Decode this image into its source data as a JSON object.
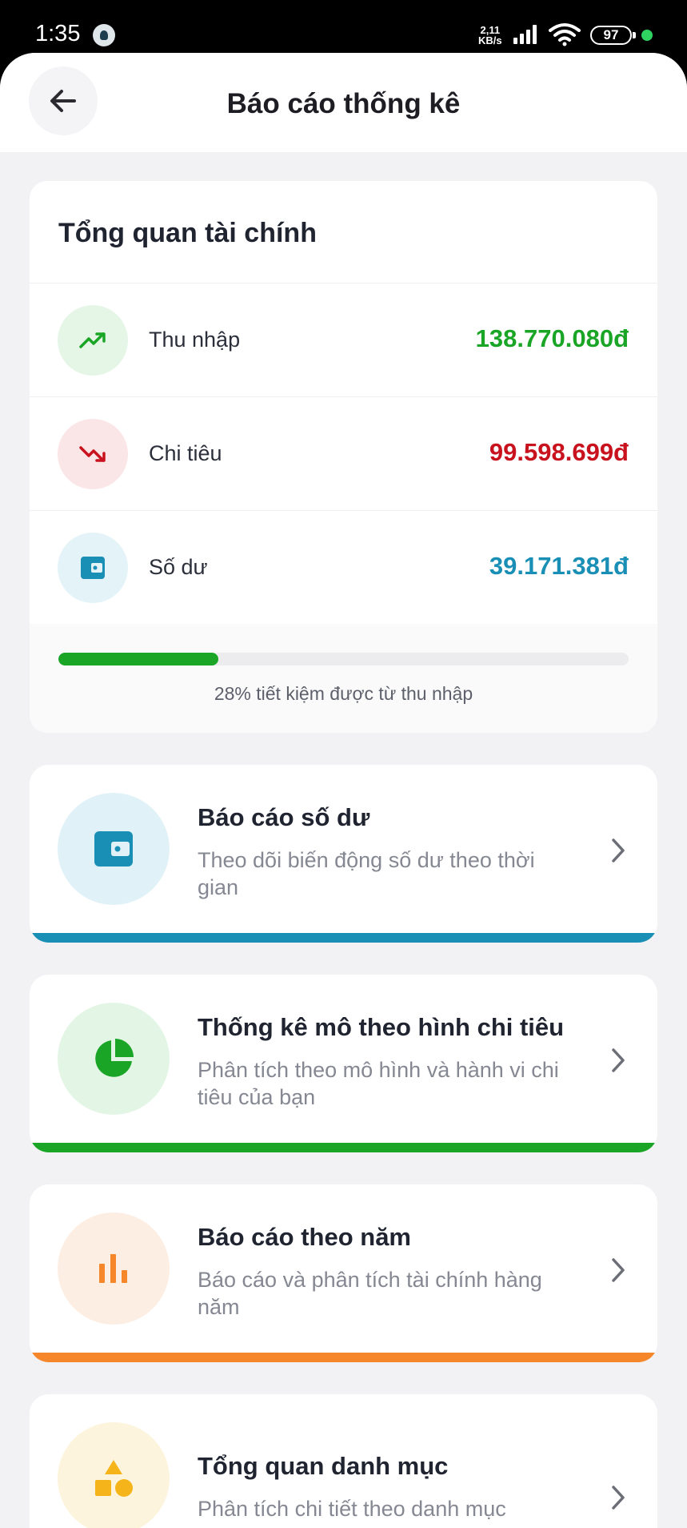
{
  "status_bar": {
    "time": "1:35",
    "net_speed_value": "2,11",
    "net_speed_unit": "KB/s",
    "battery": "97"
  },
  "header": {
    "title": "Báo cáo thống kê"
  },
  "overview": {
    "title": "Tổng quan tài chính",
    "rows": [
      {
        "label": "Thu nhập",
        "value": "138.770.080đ",
        "icon": "trending-up-icon",
        "color": "#1aa526",
        "bg": "#e5f6e7"
      },
      {
        "label": "Chi tiêu",
        "value": "99.598.699đ",
        "icon": "trending-down-icon",
        "color": "#c8121d",
        "bg": "#fbe6e7"
      },
      {
        "label": "Số dư",
        "value": "39.171.381đ",
        "icon": "wallet-icon",
        "color": "#1a8fb5",
        "bg": "#e3f3f8"
      }
    ],
    "savings_percent": 28,
    "savings_caption": "28% tiết kiệm được từ thu nhập"
  },
  "reports": [
    {
      "title": "Báo cáo số dư",
      "desc": "Theo dõi biến động số dư theo thời gian",
      "icon": "wallet-icon",
      "accent": "#1a8fb5",
      "bg": "#e0f2f8"
    },
    {
      "title": "Thống kê mô theo hình chi tiêu",
      "desc": "Phân tích theo mô hình và hành vi chi tiêu của bạn",
      "icon": "pie-chart-icon",
      "accent": "#1aa526",
      "bg": "#e3f5e5"
    },
    {
      "title": "Báo cáo theo năm",
      "desc": "Báo cáo và phân tích tài chính hàng năm",
      "icon": "bar-chart-icon",
      "accent": "#f5872a",
      "bg": "#fdeee4"
    },
    {
      "title": "Tổng quan danh mục",
      "desc": "Phân tích chi tiết theo danh mục",
      "icon": "category-shapes-icon",
      "accent": "#f5b41a",
      "bg": "#fdf4dd"
    }
  ]
}
